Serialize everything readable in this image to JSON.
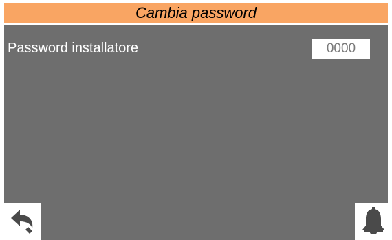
{
  "header": {
    "title": "Cambia password"
  },
  "settings": {
    "rows": [
      {
        "label": "Password installatore",
        "value": "0000"
      }
    ]
  },
  "footer": {
    "back_icon": "back-arrow-icon",
    "alarm_icon": "bell-icon"
  },
  "colors": {
    "header_bg": "#f9a563",
    "panel_bg": "#6e6e6e",
    "field_bg": "#ffffff",
    "field_text": "#7a7a7a",
    "icon": "#4a4a4a"
  }
}
